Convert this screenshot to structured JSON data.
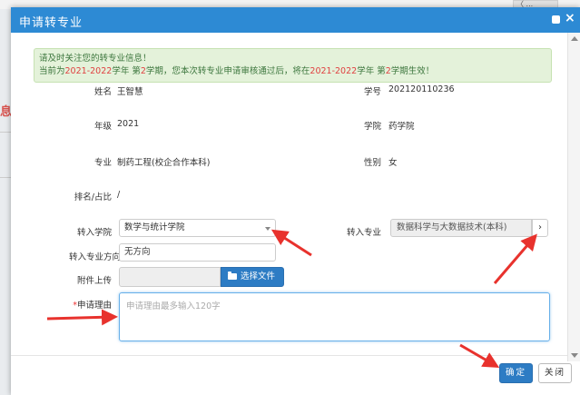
{
  "background": {
    "tab_text": "〈 ..."
  },
  "modal": {
    "title": "申请转专业",
    "notice": {
      "line1": "请及时关注您的转专业信息！",
      "line2_a": "当前为",
      "line2_year1": "2021-2022",
      "line2_b": "学年 第",
      "line2_term1": "2",
      "line2_c": "学期，您本次转专业申请审核通过后，将在",
      "line2_year2": "2021-2022",
      "line2_d": "学年 第",
      "line2_term2": "2",
      "line2_e": "学期生效！"
    },
    "info": {
      "name_label": "姓名",
      "name_value": "王智慧",
      "student_id_label": "学号",
      "student_id_value": "202120110236",
      "grade_label": "年级",
      "grade_value": "2021",
      "college_label": "学院",
      "college_value": "药学院",
      "major_label": "专业",
      "major_value": "制药工程(校企合作本科)",
      "gender_label": "性别",
      "gender_value": "女",
      "rank_label": "排名/占比",
      "rank_value": "/"
    },
    "form": {
      "target_college_label": "转入学院",
      "target_college_value": "数学与统计学院",
      "target_major_label": "转入专业",
      "target_major_value": "数据科学与大数据技术(本科)",
      "target_major_button": "›",
      "target_direction_label": "转入专业方向",
      "target_direction_value": "无方向",
      "attachment_label": "附件上传",
      "attachment_button": "选择文件",
      "reason_required_mark": "*",
      "reason_label": "申请理由",
      "reason_placeholder": "申请理由最多输入120字"
    },
    "footer": {
      "ok_label": "确定",
      "close_label": "关闭"
    }
  },
  "colors": {
    "header_blue": "#2d8ad4",
    "button_blue": "#2d7cc4",
    "notice_green_bg": "#e4f2da",
    "notice_red": "#e04040",
    "arrow_red": "#e8322d"
  }
}
